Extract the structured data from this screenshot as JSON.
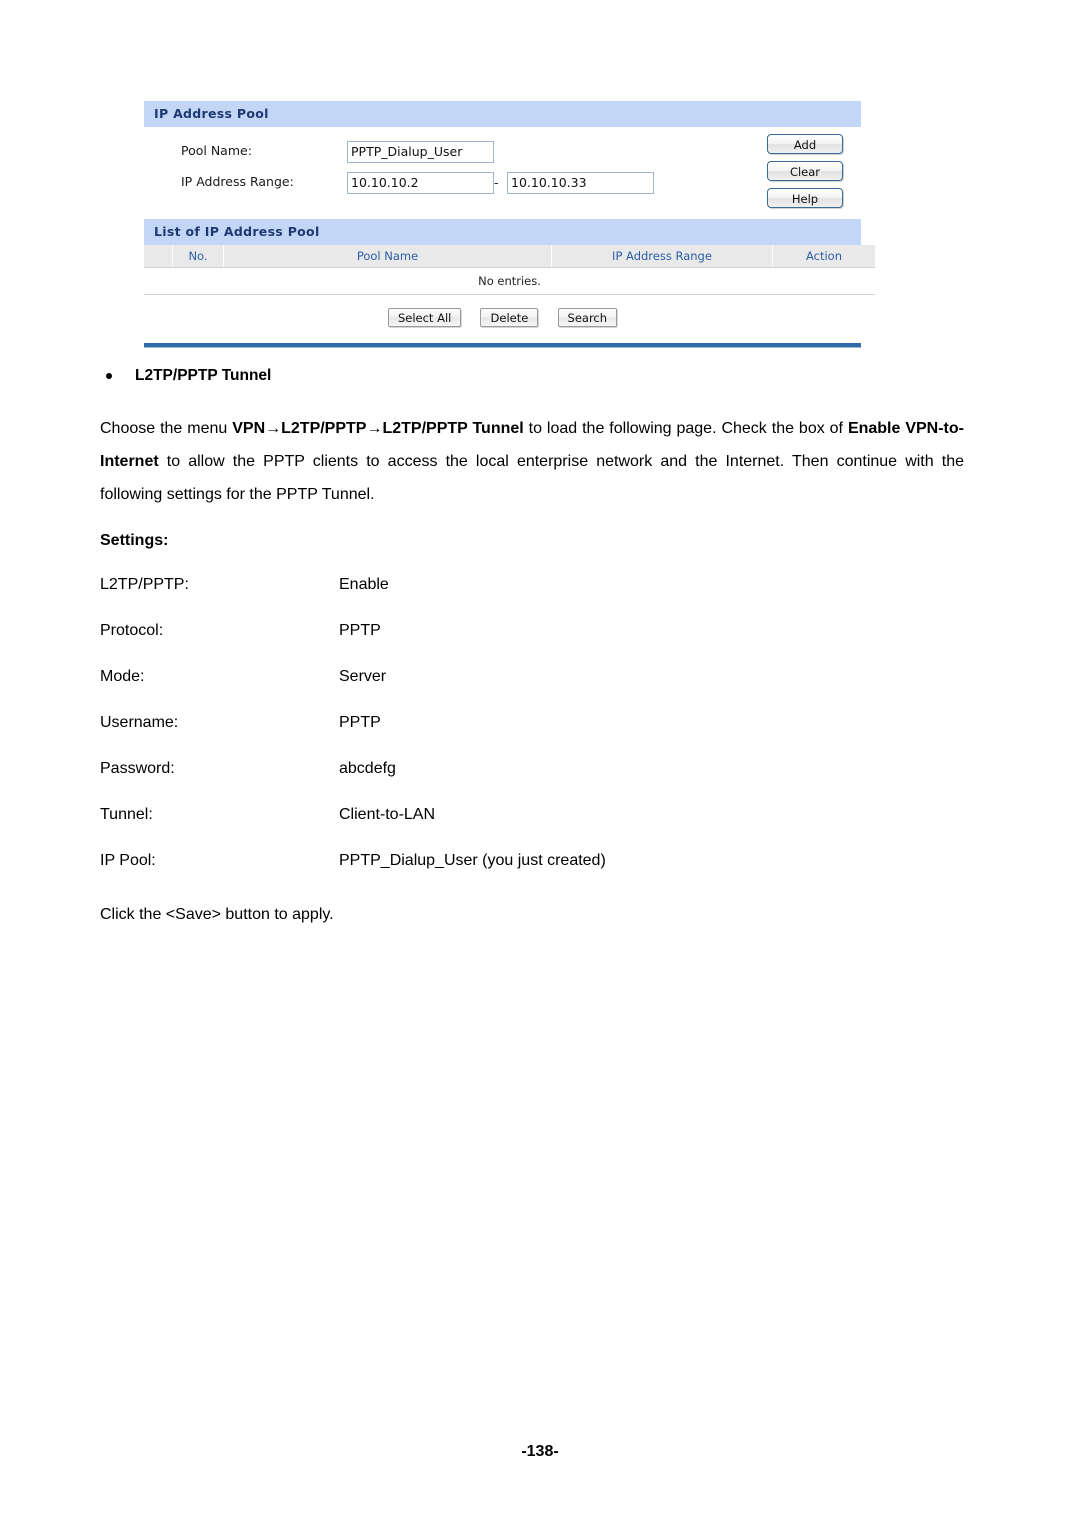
{
  "ui_panel": {
    "section_title": "IP Address Pool",
    "fields": {
      "pool_name_label": "Pool Name:",
      "pool_name_value": "PPTP_Dialup_User",
      "ip_range_label": "IP Address Range:",
      "ip_range_start": "10.10.10.2",
      "ip_range_separator": "-",
      "ip_range_end": "10.10.10.33"
    },
    "side_buttons": [
      {
        "label": "Add",
        "name": "add-button"
      },
      {
        "label": "Clear",
        "name": "clear-button"
      },
      {
        "label": "Help",
        "name": "help-button"
      }
    ],
    "list_section": {
      "title": "List of IP Address Pool",
      "columns": [
        "",
        "No.",
        "Pool Name",
        "IP Address Range",
        "Action"
      ],
      "rows": [],
      "empty_message": "No entries."
    },
    "bottom_buttons": [
      {
        "label": "Select All",
        "name": "select-all-button"
      },
      {
        "label": "Delete",
        "name": "delete-button"
      },
      {
        "label": "Search",
        "name": "search-button"
      }
    ],
    "colors": {
      "section_header_bg": "#c3d6f5",
      "section_header_text": "#1f3a73",
      "table_header_bg": "#e9e9e9",
      "table_header_text": "#2c5da8",
      "rule": "#2e6ba8",
      "button_border": "#3a6b96"
    }
  },
  "doc": {
    "bullet_heading": "L2TP/PPTP Tunnel",
    "paragraph": {
      "p1": "Choose the menu ",
      "b1": "VPN→L2TP/PPTP→L2TP/PPTP Tunnel",
      "p2": " to load the following page. Check the box of ",
      "b2": "Enable VPN-to-Internet",
      "p3": " to allow the PPTP clients to access the local enterprise network and the Internet. Then continue with the following settings for the PPTP Tunnel."
    },
    "settings_heading": "Settings:",
    "settings": [
      {
        "key": "L2TP/PPTP:",
        "value": "Enable"
      },
      {
        "key": "Protocol:",
        "value": "PPTP"
      },
      {
        "key": "Mode:",
        "value": "Server"
      },
      {
        "key": "Username:",
        "value": "PPTP"
      },
      {
        "key": "Password:",
        "value": "abcdefg"
      },
      {
        "key": "Tunnel:",
        "value": "Client-to-LAN"
      },
      {
        "key": "IP Pool:",
        "value": "PPTP_Dialup_User (you just created)"
      }
    ],
    "closing_text": "Click the <Save> button to apply."
  },
  "footer": {
    "page_number": "-138-"
  }
}
